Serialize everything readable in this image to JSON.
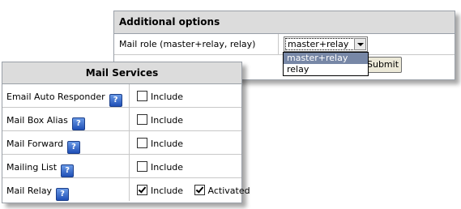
{
  "additional_options": {
    "title": "Additional options",
    "mail_role_label": "Mail role (master+relay, relay)",
    "selected_value": "master+relay",
    "options": [
      "master+relay",
      "relay"
    ],
    "submit_label": "Submit"
  },
  "mail_services": {
    "title": "Mail Services",
    "help_glyph": "?",
    "include_label": "Include",
    "activated_label": "Activated",
    "rows": [
      {
        "label": "Email Auto Responder",
        "include": false
      },
      {
        "label": "Mail Box Alias",
        "include": false
      },
      {
        "label": "Mail Forward",
        "include": false
      },
      {
        "label": "Mailing List",
        "include": false
      },
      {
        "label": "Mail Relay",
        "include": true,
        "activated": true
      }
    ]
  },
  "colors": {
    "header_bg": "#dcdcdc",
    "selected_option_bg": "#7787a6",
    "help_icon": "#2a5bc4"
  }
}
